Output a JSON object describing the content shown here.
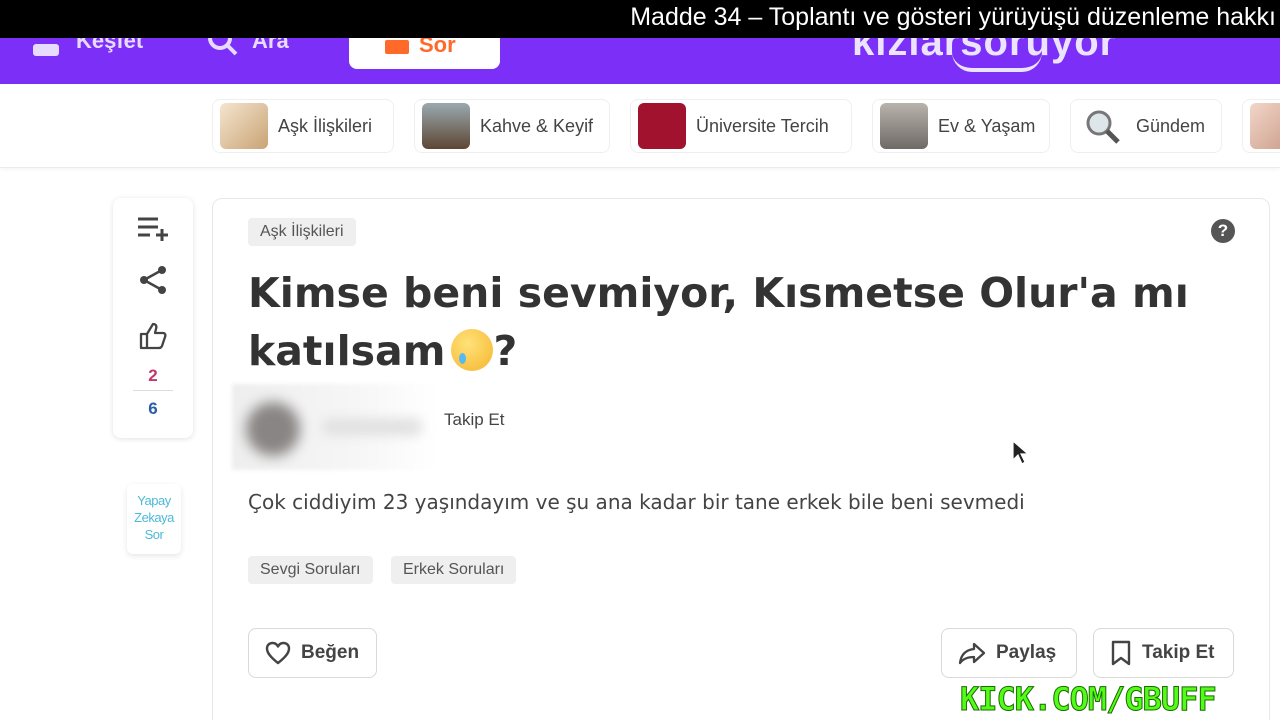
{
  "caption": {
    "text": "Madde 34 – Toplantı ve gösteri yürüyüşü düzenleme hakkı"
  },
  "header": {
    "nav_items": [
      "Keşfet",
      "Ara"
    ],
    "ask_button_label": "Sor",
    "logo_text": "kızlarsoruyor",
    "colors": {
      "background": "#7b2ff7",
      "ask_accent": "#ff6a2b"
    }
  },
  "categories": [
    {
      "label": "Aşk İlişkileri",
      "thumb_color": "#d9b98f"
    },
    {
      "label": "Kahve & Keyif",
      "thumb_color": "#6b7b83"
    },
    {
      "label": "Üniversite Tercih",
      "thumb_color": "#a1122f"
    },
    {
      "label": "Ev & Yaşam",
      "thumb_color": "#8d8a86"
    },
    {
      "label": "Gündem",
      "thumb_color": "#ffffff"
    }
  ],
  "side_actions": {
    "icons": [
      "add-to-list-icon",
      "share-icon",
      "thumbs-up-icon"
    ],
    "count_top": "2",
    "count_bottom": "6",
    "ai_label_lines": [
      "Yapay",
      "Zekaya",
      "Sor"
    ]
  },
  "question": {
    "category_tag": "Aşk İlişkileri",
    "title": "Kimse beni sevmiyor, Kısmetse Olur'a mı katılsam",
    "title_suffix": "?",
    "follow_author_label": "Takip Et",
    "body": "Çok ciddiyim 23 yaşındayım ve şu ana kadar bir tane erkek bile beni sevmedi",
    "tags": [
      "Sevgi Soruları",
      "Erkek Soruları"
    ],
    "actions": {
      "like_label": "Beğen",
      "share_label": "Paylaş",
      "follow_label": "Takip Et"
    }
  },
  "overlay": {
    "watermark": "KICK.COM/GBUFF"
  }
}
